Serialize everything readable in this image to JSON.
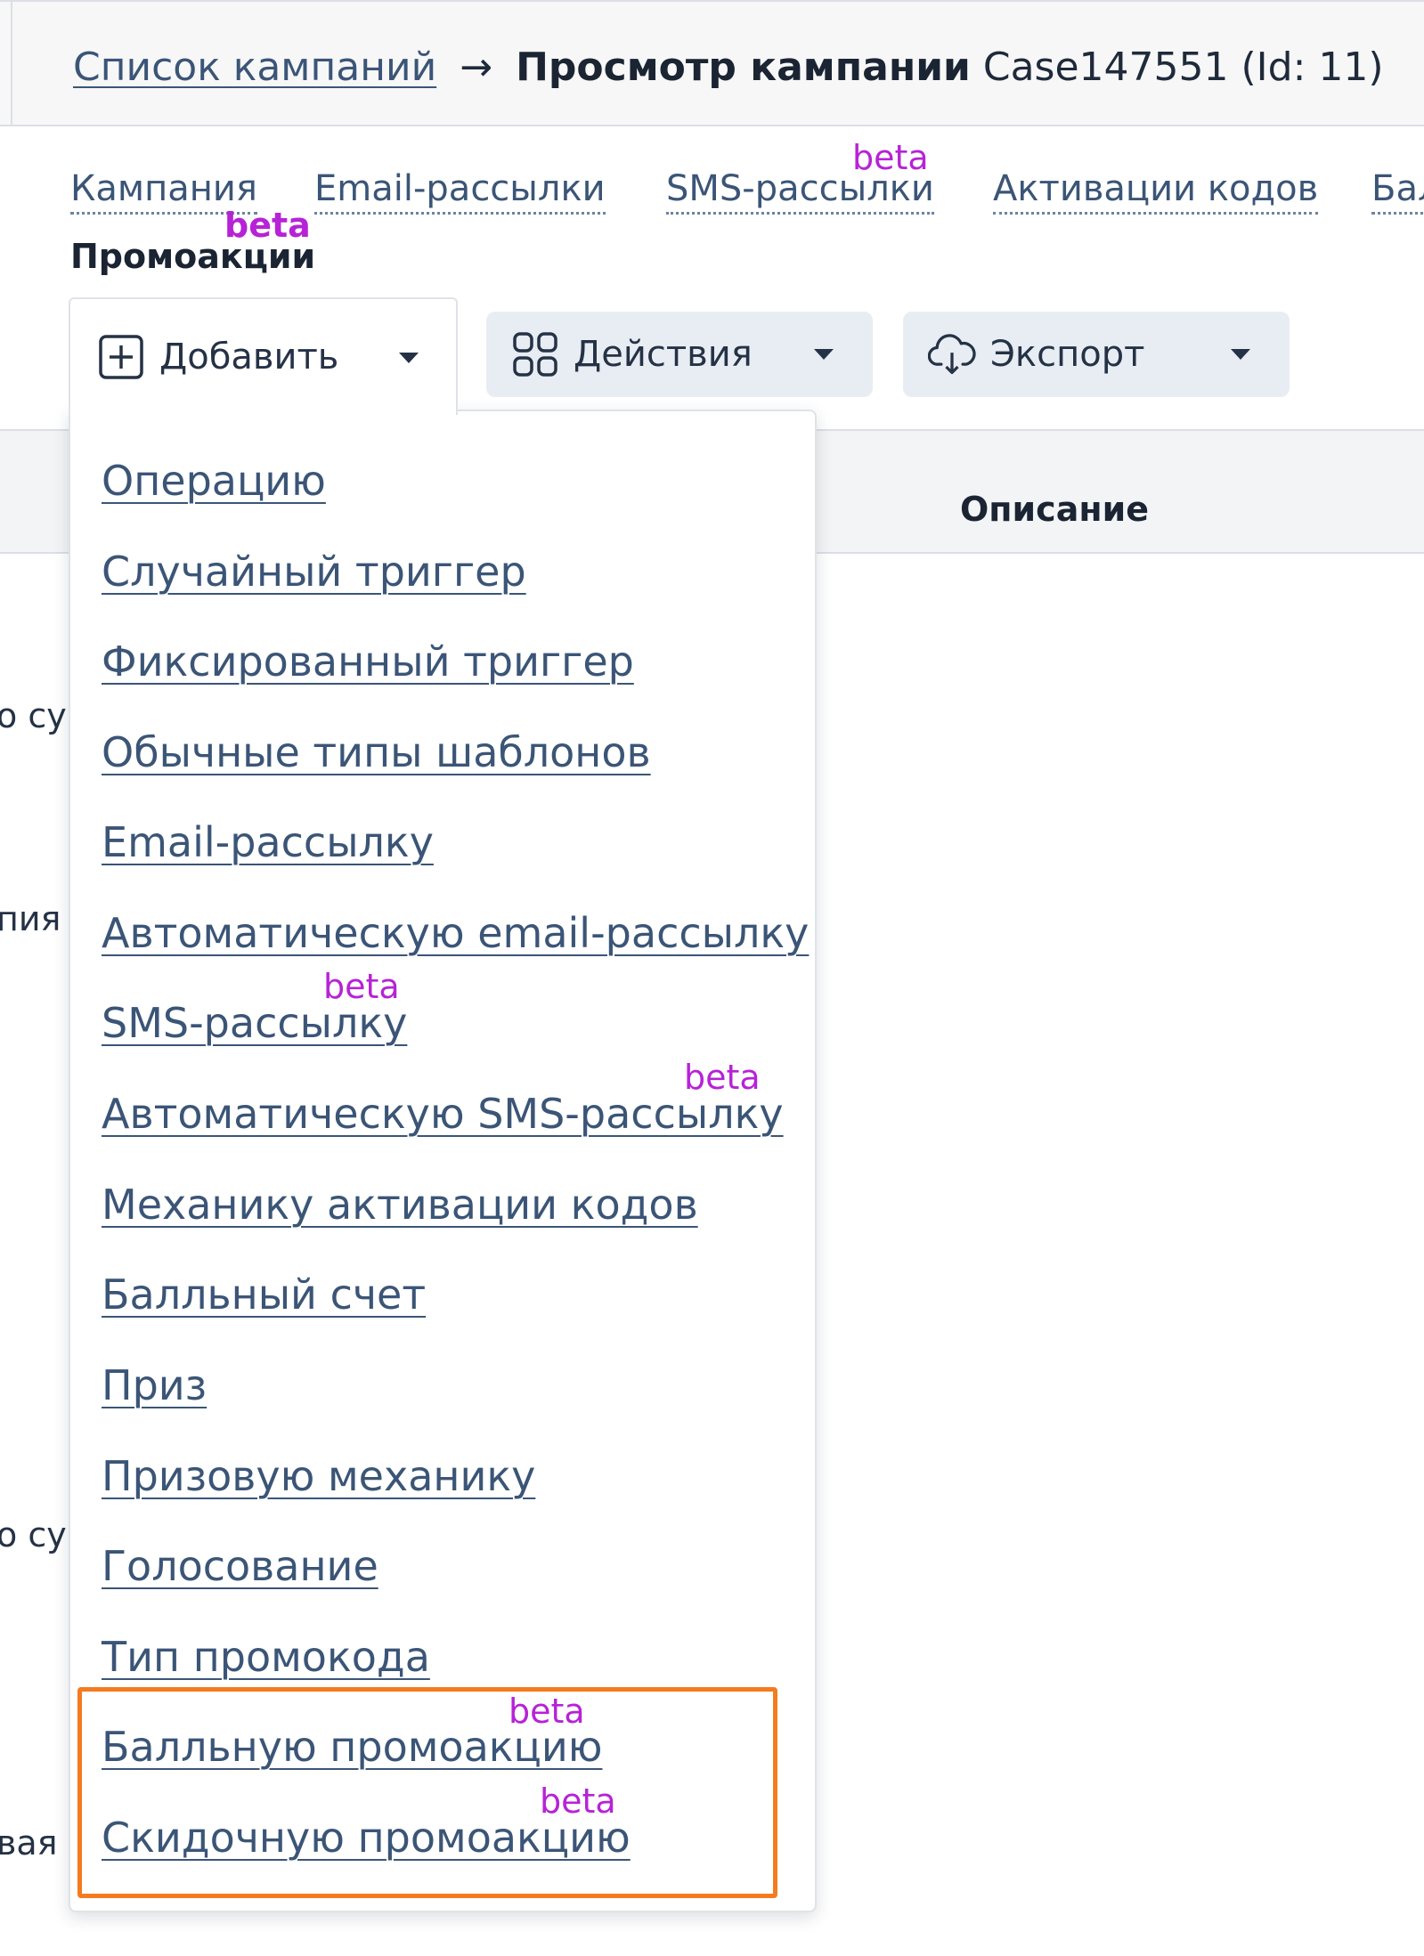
{
  "breadcrumb": {
    "link": "Список кампаний",
    "arrow": "→",
    "current_bold": "Просмотр кампании",
    "current_rest": "Case147551 (Id: 11)"
  },
  "tabs": [
    {
      "label": "Кампания",
      "beta": ""
    },
    {
      "label": "Email-рассылки",
      "beta": ""
    },
    {
      "label": "SMS-рассылки",
      "beta": "beta"
    },
    {
      "label": "Активации кодов",
      "beta": ""
    },
    {
      "label": "Бал",
      "beta": ""
    },
    {
      "label": "Промоакции",
      "beta": "beta",
      "active": true
    }
  ],
  "toolbar": {
    "add_label": "Добавить",
    "actions_label": "Действия",
    "export_label": "Экспорт"
  },
  "table": {
    "description_header": "Описание",
    "row_fragments": [
      "о су",
      "пия",
      "о су",
      "вая"
    ]
  },
  "dropdown": {
    "items": [
      {
        "label": "Операцию",
        "beta": ""
      },
      {
        "label": "Случайный триггер",
        "beta": ""
      },
      {
        "label": "Фиксированный триггер",
        "beta": ""
      },
      {
        "label": "Обычные типы шаблонов",
        "beta": ""
      },
      {
        "label": "Email-рассылку",
        "beta": ""
      },
      {
        "label": "Автоматическую email-рассылку",
        "beta": ""
      },
      {
        "label": "SMS-рассылку",
        "beta": "beta"
      },
      {
        "label": "Автоматическую SMS-рассылку",
        "beta": "beta"
      },
      {
        "label": "Механику активации кодов",
        "beta": ""
      },
      {
        "label": "Балльный счет",
        "beta": ""
      },
      {
        "label": "Приз",
        "beta": ""
      },
      {
        "label": "Призовую механику",
        "beta": ""
      },
      {
        "label": "Голосование",
        "beta": ""
      },
      {
        "label": "Тип промокода",
        "beta": ""
      },
      {
        "label": "Балльную промоакцию",
        "beta": "beta"
      },
      {
        "label": "Скидочную промоакцию",
        "beta": "beta"
      }
    ]
  },
  "colors": {
    "accent_beta": "#b623d6",
    "link": "#3b5577",
    "highlight": "#f47b20",
    "button_bg": "#e8edf3"
  }
}
